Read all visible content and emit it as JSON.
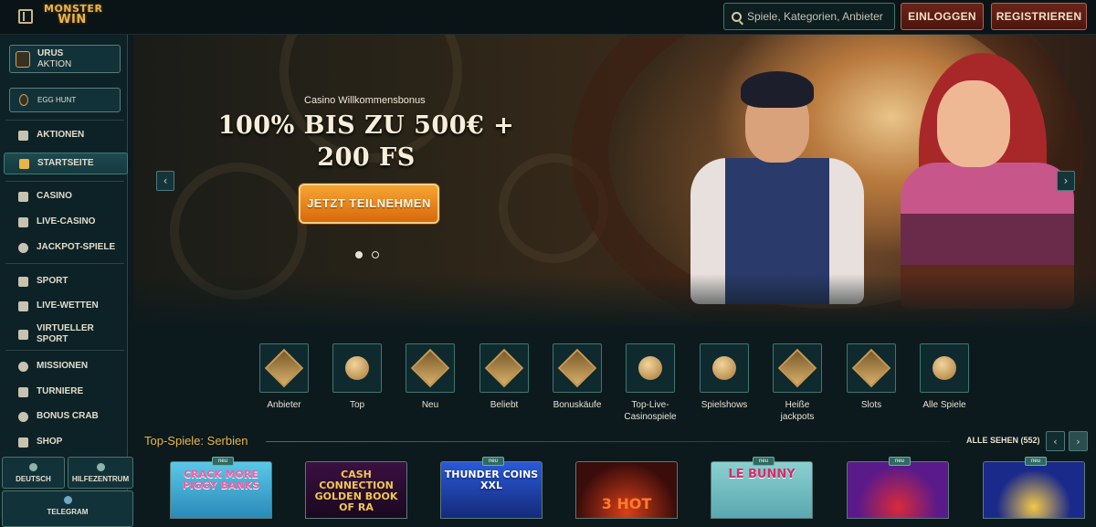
{
  "header": {
    "logo_line1": "MONSTER",
    "logo_line2": "WIN",
    "search_placeholder": "Spiele, Kategorien, Anbieter",
    "login_label": "EINLOGGEN",
    "register_label": "REGISTRIEREN"
  },
  "sidebar": {
    "promo1": {
      "title": "URUS",
      "subtitle": "AKTION"
    },
    "promo2": {
      "title": "EGG HUNT"
    },
    "items": [
      {
        "label": "AKTIONEN",
        "icon": "gift-icon"
      },
      {
        "label": "STARTSEITE",
        "icon": "home-icon",
        "active": true
      },
      {
        "label": "CASINO",
        "icon": "slot-machine-icon"
      },
      {
        "label": "LIVE-CASINO",
        "icon": "live-cards-icon"
      },
      {
        "label": "JACKPOT-SPIELE",
        "icon": "clover-icon"
      },
      {
        "label": "SPORT",
        "icon": "sport-icon"
      },
      {
        "label": "LIVE-WETTEN",
        "icon": "live-bet-icon"
      },
      {
        "label": "VIRTUELLER SPORT",
        "icon": "virtual-sport-icon"
      },
      {
        "label": "MISSIONEN",
        "icon": "mission-icon"
      },
      {
        "label": "TURNIERE",
        "icon": "trophy-icon"
      },
      {
        "label": "BONUS CRAB",
        "icon": "crab-icon"
      },
      {
        "label": "SHOP",
        "icon": "cart-icon"
      }
    ],
    "language_label": "DEUTSCH",
    "help_label": "HILFEZENTRUM",
    "telegram_label": "TELEGRAM"
  },
  "hero": {
    "subtitle": "Casino Willkommensbonus",
    "title": "100% BIS ZU 500€ + 200 FS",
    "cta_label": "JETZT TEILNEHMEN",
    "slides": 2,
    "active_slide": 1
  },
  "categories": [
    {
      "label": "Anbieter",
      "icon": "book-icon"
    },
    {
      "label": "Top",
      "icon": "crown-icon"
    },
    {
      "label": "Neu",
      "icon": "lightning-icon"
    },
    {
      "label": "Beliebt",
      "icon": "star-icon"
    },
    {
      "label": "Bonuskäufe",
      "icon": "chest-icon"
    },
    {
      "label": "Top-Live-\nCasinospiele",
      "icon": "chip-crown-icon"
    },
    {
      "label": "Spielshows",
      "icon": "wheel-icon"
    },
    {
      "label": "Heiße\njackpots",
      "icon": "flame-icon"
    },
    {
      "label": "Slots",
      "icon": "slot-icon"
    },
    {
      "label": "Alle Spiele",
      "icon": "cherries-icon"
    }
  ],
  "section": {
    "title": "Top-Spiele: Serbien",
    "see_all": "ALLE SEHEN (552)"
  },
  "games": [
    {
      "title": "CRACK MORE PIGGY BANKS",
      "badge": "neu",
      "bg": "#4ab0d8"
    },
    {
      "title": "CASH CONNECTION GOLDEN BOOK OF RA",
      "badge": "",
      "bg": "#2a1030"
    },
    {
      "title": "THUNDER COINS XXL",
      "badge": "neu",
      "bg": "#1a3a9a"
    },
    {
      "title": "3 HOT",
      "badge": "",
      "bg": "#3a0c0a"
    },
    {
      "title": "LE BUNNY",
      "badge": "neu",
      "bg": "#6ab0b0"
    },
    {
      "title": "",
      "badge": "neu",
      "bg": "#5a1a8a"
    },
    {
      "title": "",
      "badge": "neu",
      "bg": "#1a2a8a"
    }
  ],
  "colors": {
    "accent_gold": "#e8b54a",
    "cta_orange": "#e8841c",
    "register_red": "#6b2418",
    "teal_border": "#3f7670"
  }
}
